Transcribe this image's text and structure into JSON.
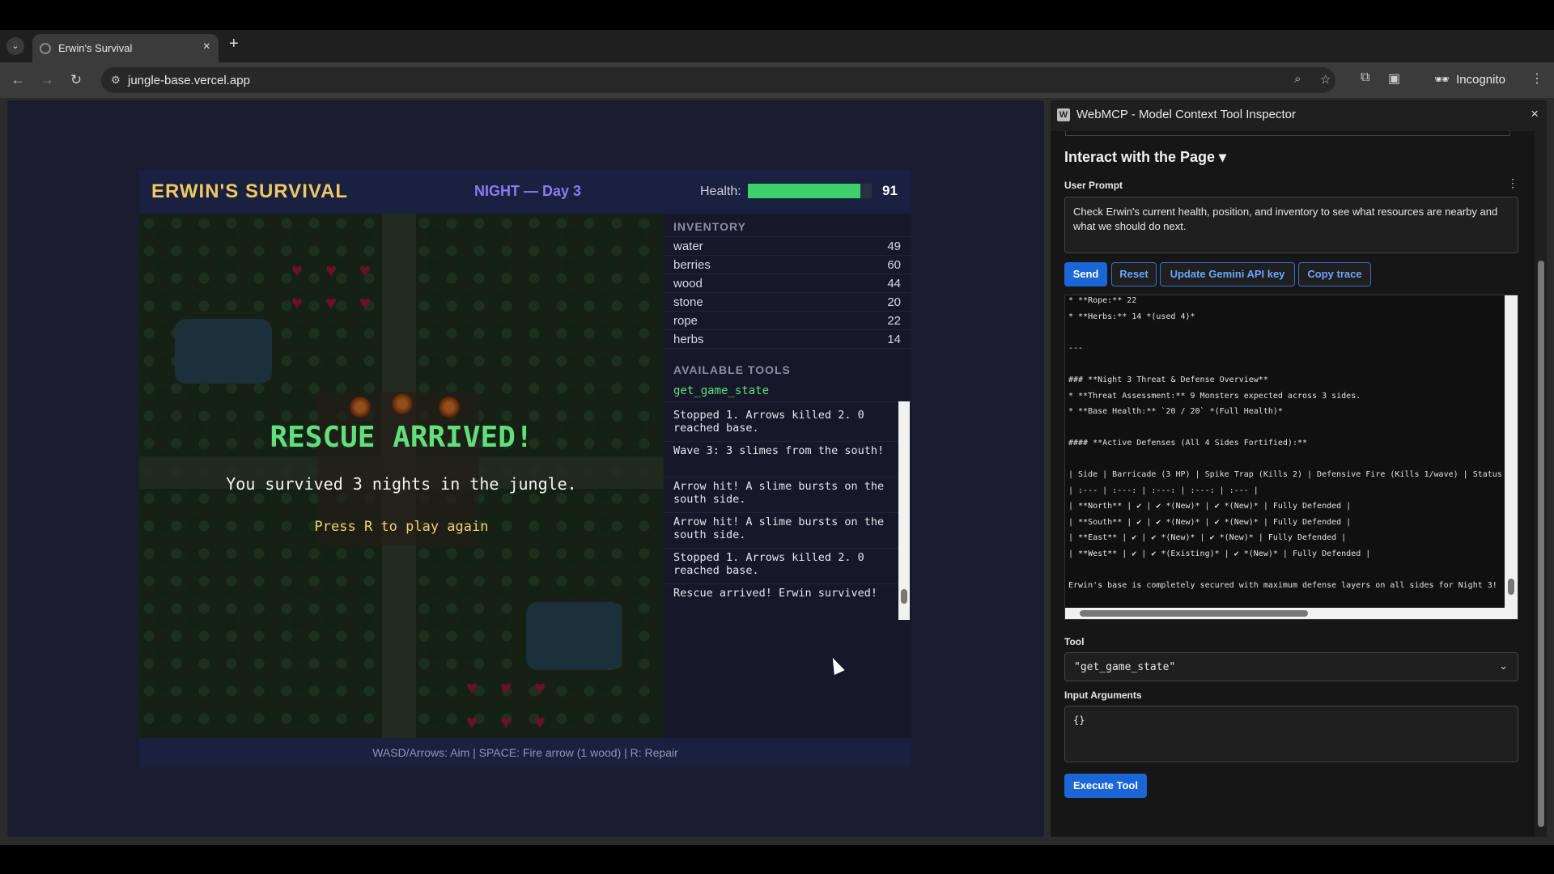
{
  "browser": {
    "tab_title": "Erwin's Survival",
    "url": "jungle-base.vercel.app",
    "incognito_label": "Incognito"
  },
  "game": {
    "title": "ERWIN'S SURVIVAL",
    "phase": "NIGHT — Day 3",
    "health_label": "Health:",
    "health_value": "91",
    "health_fraction": 0.91,
    "overlay": {
      "title": "RESCUE ARRIVED!",
      "subtitle": "You survived 3 nights in the jungle.",
      "hint": "Press R to play again"
    },
    "inventory_title": "INVENTORY",
    "inventory": [
      {
        "name": "water",
        "value": "49"
      },
      {
        "name": "berries",
        "value": "60"
      },
      {
        "name": "wood",
        "value": "44"
      },
      {
        "name": "stone",
        "value": "20"
      },
      {
        "name": "rope",
        "value": "22"
      },
      {
        "name": "herbs",
        "value": "14"
      }
    ],
    "tools_title": "AVAILABLE TOOLS",
    "tools": [
      "get_game_state"
    ],
    "log": [
      "Stopped 1. Arrows killed 2. 0 reached base.",
      "Wave 3: 3 slimes from the south!",
      "Arrow hit! A slime bursts on the south side.",
      "Arrow hit! A slime bursts on the south side.",
      "Stopped 1. Arrows killed 2. 0 reached base.",
      "Rescue arrived! Erwin survived!"
    ],
    "controls": "WASD/Arrows: Aim | SPACE: Fire arrow (1 wood) | R: Repair"
  },
  "inspector": {
    "title": "WebMCP - Model Context Tool Inspector",
    "heading": "Interact with the Page ▾",
    "user_prompt_label": "User Prompt",
    "user_prompt": "Check Erwin's current health, position, and inventory to see what resources are nearby and what we should do next.",
    "buttons": {
      "send": "Send",
      "reset": "Reset",
      "update_key": "Update Gemini API key",
      "copy_trace": "Copy trace"
    },
    "trace": [
      "* **Rope:** 22",
      "* **Herbs:** 14 *(used 4)*",
      "",
      "---",
      "",
      "### **Night 3 Threat & Defense Overview**",
      "* **Threat Assessment:** 9 Monsters expected across 3 sides.",
      "* **Base Health:** `20 / 20` *(Full Health)*",
      "",
      "#### **Active Defenses (All 4 Sides Fortified):**",
      "",
      "| Side | Barricade (3 HP) | Spike Trap (Kills 2) | Defensive Fire (Kills 1/wave) | Status |",
      "| :--- | :---: | :---: | :---: | :--- |",
      "| **North** | ✔ | ✔ *(New)* | ✔ *(New)* | Fully Defended |",
      "| **South** | ✔ | ✔ *(New)* | ✔ *(New)* | Fully Defended |",
      "| **East** | ✔ | ✔ *(New)* | ✔ *(New)* | Fully Defended |",
      "| **West** | ✔ | ✔ *(Existing)* | ✔ *(New)* | Fully Defended |",
      "",
      "Erwin's base is completely secured with maximum defense layers on all sides for Night 3!"
    ],
    "tool_label": "Tool",
    "tool_value": "\"get_game_state\"",
    "args_label": "Input Arguments",
    "args_value": "{}",
    "execute": "Execute Tool"
  }
}
